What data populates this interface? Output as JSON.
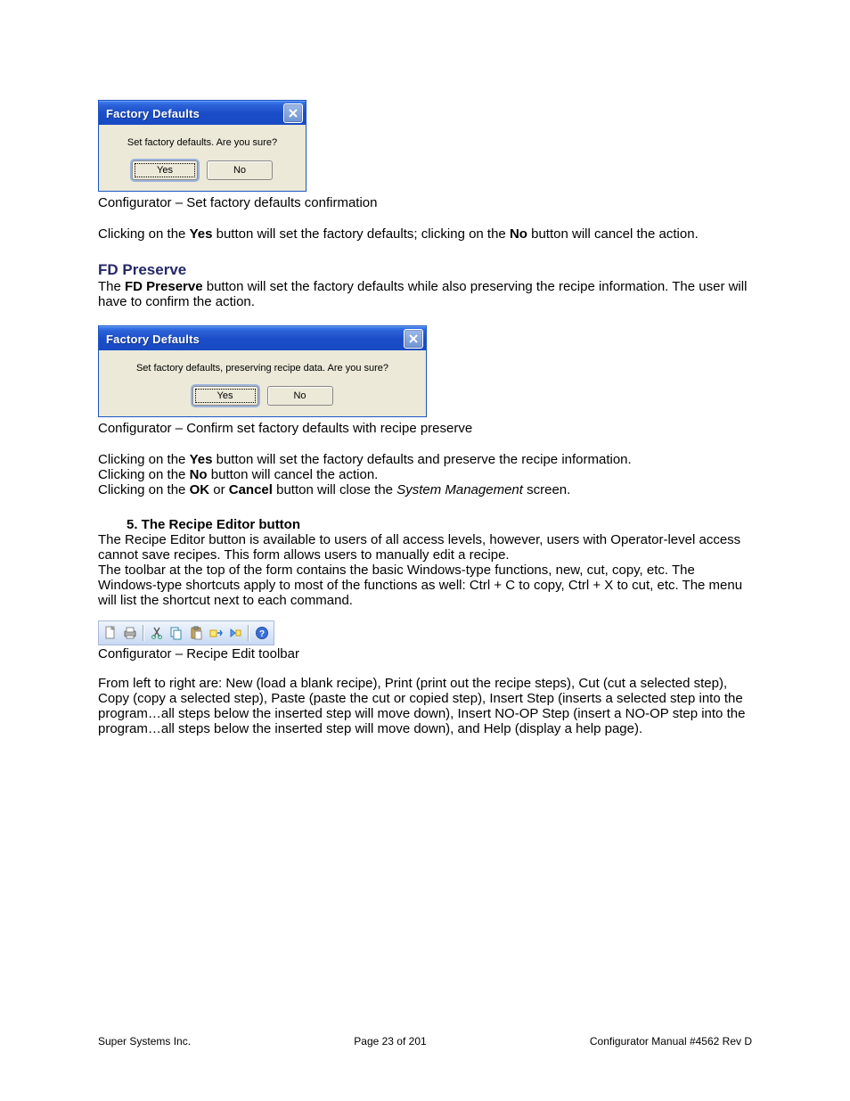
{
  "dialog1": {
    "title": "Factory Defaults",
    "message": "Set factory defaults.  Are you sure?",
    "yes": "Yes",
    "no": "No"
  },
  "caption1": "Configurator – Set factory defaults confirmation",
  "para1a": "Clicking on the ",
  "para1b": "Yes",
  "para1c": " button will set the factory defaults; clicking on the ",
  "para1d": "No",
  "para1e": " button will cancel the action.",
  "h_fd": "FD Preserve",
  "fd1a": "The ",
  "fd1b": "FD Preserve",
  "fd1c": " button will set the factory defaults while also preserving the recipe information.  The user will have to confirm the action.",
  "dialog2": {
    "title": "Factory Defaults",
    "message": "Set factory defaults, preserving recipe data.  Are you sure?",
    "yes": "Yes",
    "no": "No"
  },
  "caption2": "Configurator – Confirm set factory defaults with recipe preserve",
  "para2a": "Clicking on the ",
  "para2b": "Yes",
  "para2c": " button will set the factory defaults and preserve the recipe information.",
  "para3a": "Clicking on the ",
  "para3b": "No",
  "para3c": " button will cancel the action.",
  "para4a": "Clicking on the ",
  "para4b": "OK",
  "para4c": " or ",
  "para4d": "Cancel",
  "para4e": " button will close the ",
  "para4f": "System Management",
  "para4g": " screen.",
  "section5_heading": "5.  The Recipe Editor button",
  "section5_p1": "The Recipe Editor button is available to users of all access levels, however, users with Operator-level access cannot save recipes.  This form allows users to manually edit a recipe.",
  "section5_p2": "The toolbar at the top of the form contains the basic Windows-type functions, new, cut, copy, etc. The Windows-type shortcuts apply to most of the functions as well: Ctrl + C to copy, Ctrl + X to cut, etc.  The menu will list the shortcut next to each command.",
  "caption3": "Configurator – Recipe Edit toolbar",
  "para_last": "From left to right are: New (load a blank recipe), Print (print out the recipe steps), Cut (cut a selected step), Copy (copy a selected step), Paste (paste the cut or copied step), Insert Step (inserts a selected step into the program…all steps below the inserted step will move down), Insert NO-OP Step (insert a NO-OP step into the program…all steps below the inserted step will move down), and Help (display a help page).",
  "footer": {
    "left": "Super Systems Inc.",
    "center": "Page 23 of 201",
    "right": "Configurator Manual #4562 Rev D"
  },
  "toolbar_icons": [
    "new",
    "print",
    "cut",
    "copy",
    "paste",
    "insert-step",
    "insert-noop",
    "help"
  ]
}
